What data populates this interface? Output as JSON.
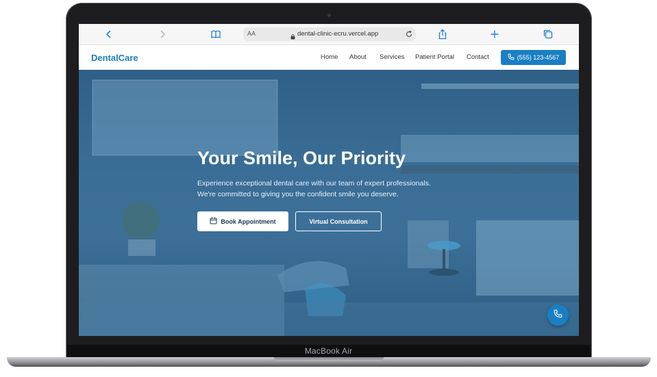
{
  "device": {
    "label": "MacBook Air"
  },
  "browser": {
    "text_size_label": "AA",
    "url": "dental-clinic-ecru.vercel.app",
    "icons": [
      "back-icon",
      "forward-icon",
      "bookmarks-icon",
      "lock-icon",
      "reload-icon",
      "share-icon",
      "new-tab-icon",
      "tabs-icon"
    ]
  },
  "site": {
    "logo": "DentalCare",
    "nav": {
      "items": [
        {
          "label": "Home"
        },
        {
          "label": "About"
        },
        {
          "label": "Services"
        },
        {
          "label": "Patient Portal"
        },
        {
          "label": "Contact"
        }
      ],
      "phone_button": "(555) 123-4567"
    },
    "hero": {
      "title": "Your Smile, Our Priority",
      "subtitle_line1": "Experience exceptional dental care with our team of expert professionals.",
      "subtitle_line2": "We're committed to giving you the confident smile you deserve.",
      "primary_button": "Book Appointment",
      "secondary_button": "Virtual Consultation"
    },
    "colors": {
      "brand": "#1a7fb5",
      "button": "#1a7fc2",
      "hero_overlay": "#2f5f86"
    }
  }
}
